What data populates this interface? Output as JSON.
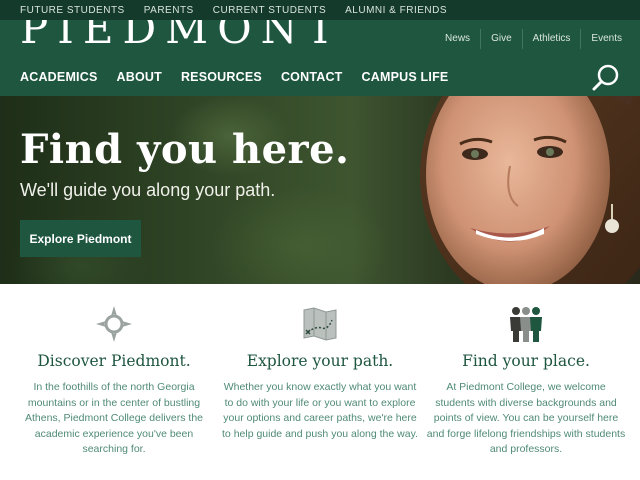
{
  "utility_nav": [
    "FUTURE STUDENTS",
    "PARENTS",
    "CURRENT STUDENTS",
    "ALUMNI & FRIENDS"
  ],
  "header": {
    "logo_text": "PIEDMONT",
    "top_links": [
      "News",
      "Give",
      "Athletics",
      "Events"
    ],
    "main_nav": [
      "ACADEMICS",
      "ABOUT",
      "RESOURCES",
      "CONTACT",
      "CAMPUS LIFE"
    ],
    "search_icon": "search-icon"
  },
  "hero": {
    "title": "Find you here.",
    "subtitle": "We'll guide you along your path.",
    "button_label": "Explore Piedmont"
  },
  "features": [
    {
      "icon": "compass-icon",
      "title": "Discover Piedmont.",
      "text": "In the foothills of the north Georgia mountains or in the center of bustling Athens, Piedmont College delivers the academic experience you've been searching for."
    },
    {
      "icon": "map-icon",
      "title": "Explore your path.",
      "text": "Whether you know exactly what you want to do with your life or you want to explore your options and career paths, we're here to help guide and push you along the way."
    },
    {
      "icon": "people-icon",
      "title": "Find your place.",
      "text": "At Piedmont College, we welcome students with diverse backgrounds and points of view. You can be yourself here and forge lifelong friendships with students and professors."
    }
  ],
  "colors": {
    "primary_green": "#1e5640",
    "dark_green": "#143a2b",
    "body_text": "#4f8a76"
  }
}
